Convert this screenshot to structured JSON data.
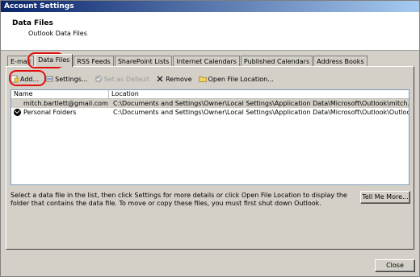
{
  "window": {
    "title": "Account Settings"
  },
  "header": {
    "title": "Data Files",
    "subtitle": "Outlook Data Files"
  },
  "tabs": [
    {
      "label": "E-mail",
      "active": false
    },
    {
      "label": "Data Files",
      "active": true
    },
    {
      "label": "RSS Feeds",
      "active": false
    },
    {
      "label": "SharePoint Lists",
      "active": false
    },
    {
      "label": "Internet Calendars",
      "active": false
    },
    {
      "label": "Published Calendars",
      "active": false
    },
    {
      "label": "Address Books",
      "active": false
    }
  ],
  "toolbar": {
    "add": "Add...",
    "settings": "Settings...",
    "set_default": "Set as Default",
    "remove": "Remove",
    "open_location": "Open File Location..."
  },
  "list": {
    "columns": [
      "Name",
      "Location"
    ],
    "rows": [
      {
        "name": "mitch.bartlett@gmail.com",
        "location": "C:\\Documents and Settings\\Owner\\Local Settings\\Application Data\\Microsoft\\Outlook\\mitch.bartlett@g...",
        "default": false,
        "selected": true
      },
      {
        "name": "Personal Folders",
        "location": "C:\\Documents and Settings\\Owner\\Local Settings\\Application Data\\Microsoft\\Outlook\\Outlook.pst",
        "default": true,
        "selected": false
      }
    ]
  },
  "description": "Select a data file in the list, then click Settings for more details or click Open File Location to display the folder that contains the data file. To move or copy these files, you must first shut down Outlook.",
  "buttons": {
    "tell_me_more": "Tell Me More...",
    "close": "Close"
  },
  "colors": {
    "annotation": "#e01010",
    "title_bar": "#0a246a"
  }
}
